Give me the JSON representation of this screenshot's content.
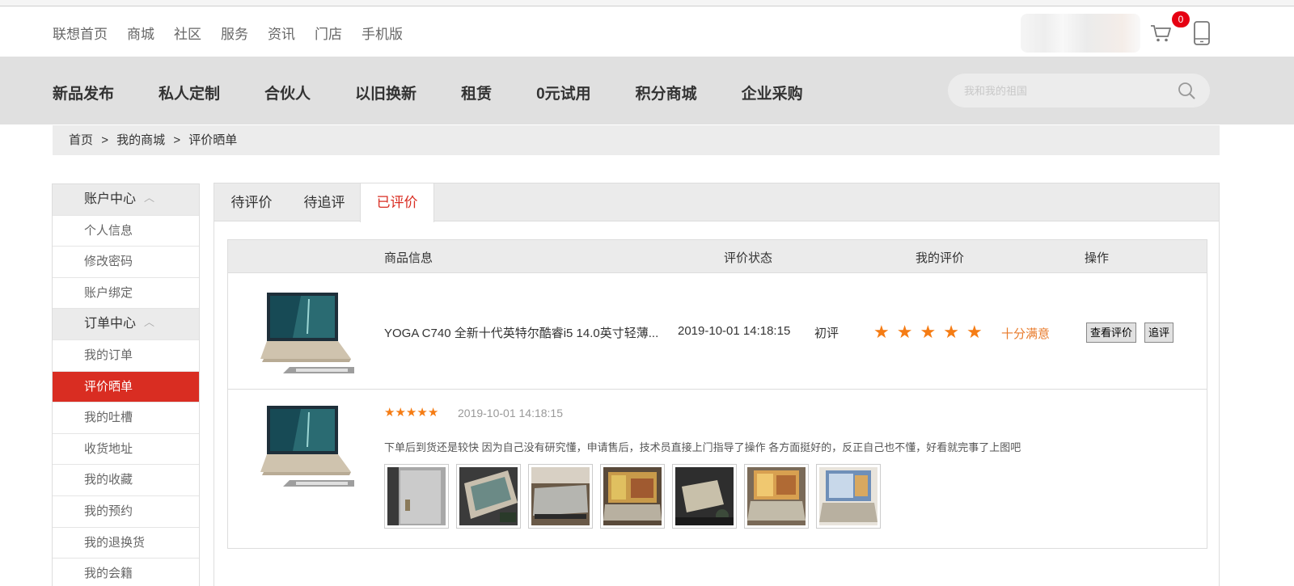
{
  "topnav": {
    "links": [
      "联想首页",
      "商城",
      "社区",
      "服务",
      "资讯",
      "门店",
      "手机版"
    ],
    "cart_count": "0"
  },
  "mainmenu": {
    "items": [
      "新品发布",
      "私人定制",
      "合伙人",
      "以旧换新",
      "租赁",
      "0元试用",
      "积分商城",
      "企业采购"
    ],
    "search_placeholder": "我和我的祖国"
  },
  "breadcrumb": {
    "items": [
      "首页",
      ">",
      "我的商城",
      ">",
      "评价晒单"
    ]
  },
  "sidebar": {
    "sections": [
      {
        "title": "账户中心",
        "items": [
          "个人信息",
          "修改密码",
          "账户绑定"
        ]
      },
      {
        "title": "订单中心",
        "items": [
          "我的订单",
          "评价晒单",
          "我的吐槽",
          "收货地址",
          "我的收藏",
          "我的预约",
          "我的退换货",
          "我的会籍"
        ]
      }
    ],
    "active": "评价晒单"
  },
  "tabs": {
    "items": [
      "待评价",
      "待追评",
      "已评价"
    ],
    "active": "已评价"
  },
  "table": {
    "headers": [
      "商品信息",
      "评价状态",
      "我的评价",
      "操作"
    ],
    "row": {
      "product_name": "YOGA C740 全新十代英特尔酷睿i5 14.0英寸轻薄...",
      "time": "2019-10-01 14:18:15",
      "status": "初评",
      "rating": 5,
      "satisfaction": "十分满意",
      "view_button": "查看评价",
      "followup_button": "追评"
    },
    "review": {
      "rating": 5,
      "time": "2019-10-01 14:18:15",
      "text": "下单后到货还是较快 因为自己没有研究懂，申请售后，技术员直接上门指导了操作 各方面挺好的，反正自己也不懂，好看就完事了上图吧",
      "photo_count": 7
    }
  },
  "colors": {
    "accent": "#d92d22",
    "star": "#f57c14",
    "badge": "#e60012"
  }
}
